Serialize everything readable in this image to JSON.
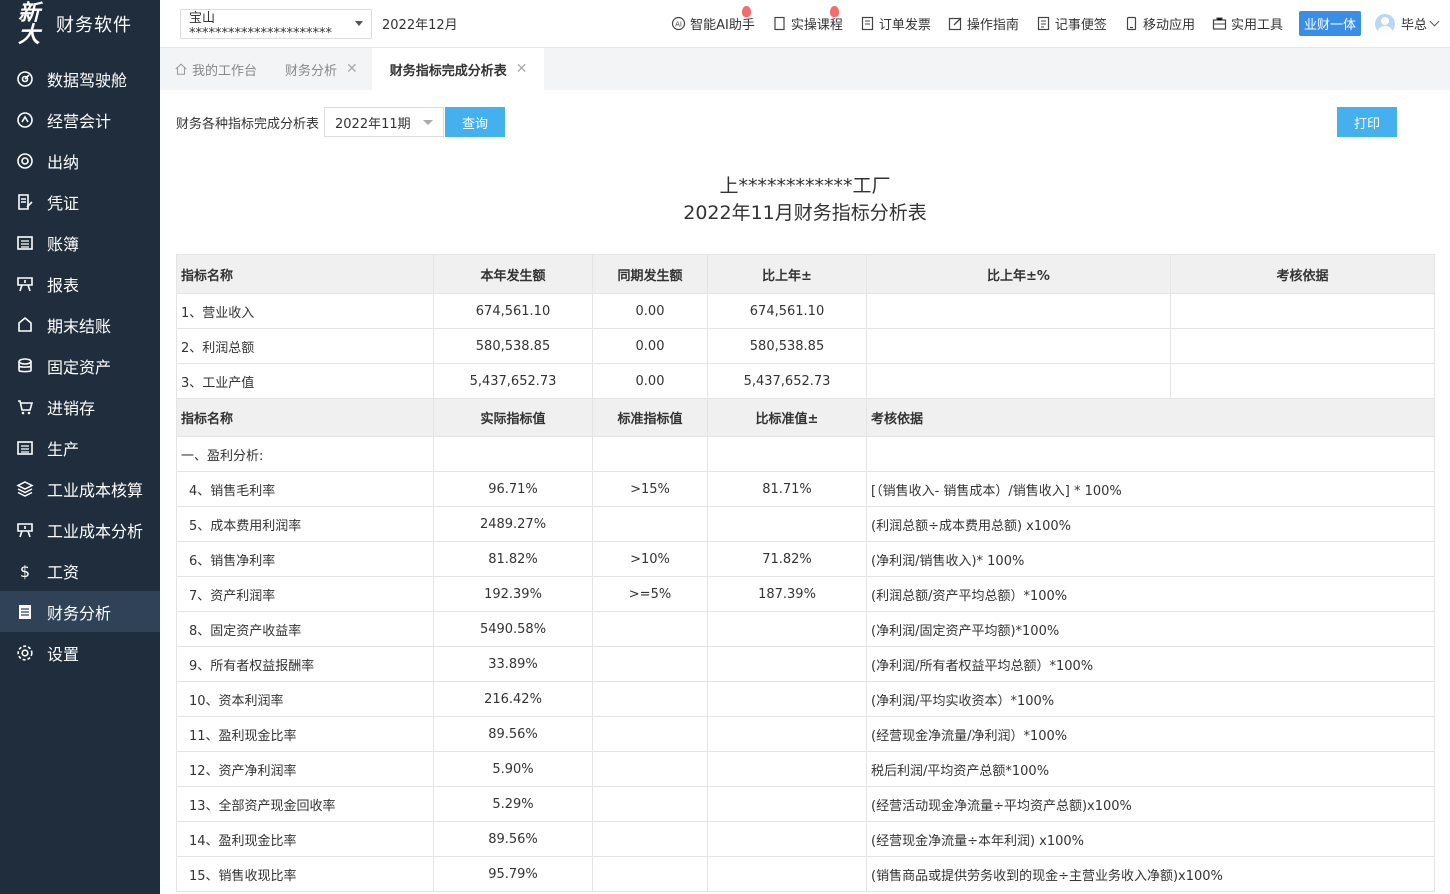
{
  "app": {
    "logo_mark": "新\n大",
    "name": "财务软件"
  },
  "sidebar": {
    "items": [
      {
        "label": "数据驾驶舱",
        "icon": "dashboard-icon"
      },
      {
        "label": "经营会计",
        "icon": "accounting-icon"
      },
      {
        "label": "出纳",
        "icon": "cashier-icon"
      },
      {
        "label": "凭证",
        "icon": "voucher-icon"
      },
      {
        "label": "账簿",
        "icon": "ledger-icon"
      },
      {
        "label": "报表",
        "icon": "report-icon"
      },
      {
        "label": "期末结账",
        "icon": "closing-icon"
      },
      {
        "label": "固定资产",
        "icon": "assets-icon"
      },
      {
        "label": "进销存",
        "icon": "cart-icon"
      },
      {
        "label": "生产",
        "icon": "production-icon"
      },
      {
        "label": "工业成本核算",
        "icon": "cost-calc-icon"
      },
      {
        "label": "工业成本分析",
        "icon": "cost-analysis-icon"
      },
      {
        "label": "工资",
        "icon": "salary-icon"
      },
      {
        "label": "财务分析",
        "icon": "finance-analysis-icon"
      },
      {
        "label": "设置",
        "icon": "settings-icon"
      }
    ],
    "active_index": 13
  },
  "topbar": {
    "company": "宝山**********************",
    "period": "2022年12月",
    "menu": [
      {
        "label": "智能AI助手",
        "hot": true
      },
      {
        "label": "实操课程",
        "hot": true
      },
      {
        "label": "订单发票",
        "hot": false
      },
      {
        "label": "操作指南",
        "hot": false
      },
      {
        "label": "记事便签",
        "hot": false
      },
      {
        "label": "移动应用",
        "hot": false
      },
      {
        "label": "实用工具",
        "hot": false
      }
    ],
    "biz_button": "业财一体",
    "user": "毕总"
  },
  "tabs": [
    {
      "label": "我的工作台",
      "closable": false
    },
    {
      "label": "财务分析",
      "closable": true
    },
    {
      "label": "财务指标完成分析表",
      "closable": true,
      "active": true
    }
  ],
  "filter": {
    "label": "财务各种指标完成分析表",
    "period": "2022年11期",
    "query": "查询",
    "print": "打印"
  },
  "report": {
    "company": "上************工厂",
    "title": "2022年11月财务指标分析表"
  },
  "table1": {
    "headers": [
      "指标名称",
      "本年发生额",
      "同期发生额",
      "比上年±",
      "比上年±%",
      "考核依据"
    ],
    "rows": [
      [
        "1、营业收入",
        "674,561.10",
        "0.00",
        "674,561.10",
        "",
        ""
      ],
      [
        "2、利润总额",
        "580,538.85",
        "0.00",
        "580,538.85",
        "",
        ""
      ],
      [
        "3、工业产值",
        "5,437,652.73",
        "0.00",
        "5,437,652.73",
        "",
        ""
      ]
    ]
  },
  "table2": {
    "headers": [
      "指标名称",
      "实际指标值",
      "标准指标值",
      "比标准值±",
      "考核依据"
    ],
    "section": "一、盈利分析:",
    "rows": [
      [
        "4、销售毛利率",
        "96.71%",
        ">15%",
        "81.71%",
        "[（销售收入- 销售成本）/销售收入] * 100%"
      ],
      [
        "5、成本费用利润率",
        "2489.27%",
        "",
        "",
        "(利润总额÷成本费用总额) x100%"
      ],
      [
        "6、销售净利率",
        "81.82%",
        ">10%",
        "71.82%",
        "(净利润/销售收入)* 100%"
      ],
      [
        "7、资产利润率",
        "192.39%",
        ">=5%",
        "187.39%",
        "(利润总额/资产平均总额）*100%"
      ],
      [
        "8、固定资产收益率",
        "5490.58%",
        "",
        "",
        "(净利润/固定资产平均额)*100%"
      ],
      [
        "9、所有者权益报酬率",
        "33.89%",
        "",
        "",
        "(净利润/所有者权益平均总额）*100%"
      ],
      [
        "10、资本利润率",
        "216.42%",
        "",
        "",
        "(净利润/平均实收资本）*100%"
      ],
      [
        "11、盈利现金比率",
        "89.56%",
        "",
        "",
        "(经营现金净流量/净利润）*100%"
      ],
      [
        "12、资产净利润率",
        "5.90%",
        "",
        "",
        "税后利润/平均资产总额*100%"
      ],
      [
        "13、全部资产现金回收率",
        "5.29%",
        "",
        "",
        "(经营活动现金净流量÷平均资产总额)x100%"
      ],
      [
        "14、盈利现金比率",
        "89.56%",
        "",
        "",
        "(经营现金净流量÷本年利润) x100%"
      ],
      [
        "15、销售收现比率",
        "95.79%",
        "",
        "",
        "(销售商品或提供劳务收到的现金÷主营业务收入净额)x100%"
      ]
    ]
  },
  "colors": {
    "sidebar_bg": "#1f2d3d",
    "sidebar_active": "#2f4257",
    "button_blue": "#45b0ee",
    "biz_blue": "#3a8ee6"
  }
}
